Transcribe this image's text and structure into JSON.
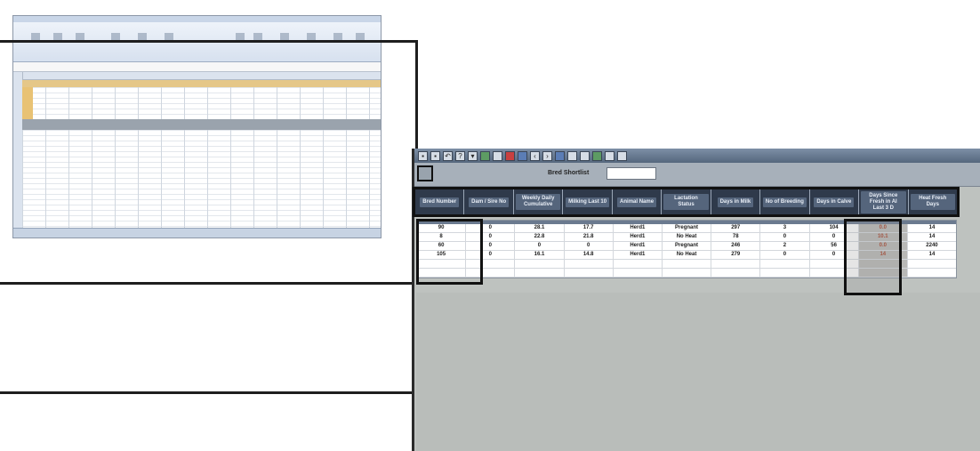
{
  "search": {
    "label": "Bred Shortlist",
    "value": ""
  },
  "table": {
    "headers": [
      "Bred Number",
      "Dam / Sire No",
      "Weekly Daily Cumulative",
      "Milking Last 10",
      "Animal Name",
      "Lactation Status",
      "Days in Milk",
      "No of Breeding",
      "Days in Calve",
      "Days Since Fresh in AI Last 3 D",
      "Heat Fresh Days"
    ],
    "rows": [
      [
        "90",
        "0",
        "28.1",
        "17.7",
        "Herd1",
        "Pregnant",
        "297",
        "3",
        "104",
        "0.0",
        "14"
      ],
      [
        "8",
        "0",
        "22.8",
        "21.8",
        "Herd1",
        "No Heat",
        "78",
        "0",
        "0",
        "10.1",
        "14"
      ],
      [
        "60",
        "0",
        "0",
        "0",
        "Herd1",
        "Pregnant",
        "246",
        "2",
        "56",
        "0.0",
        "2240"
      ],
      [
        "105",
        "0",
        "16.1",
        "14.8",
        "Herd1",
        "No Heat",
        "279",
        "0",
        "0",
        "14",
        "14"
      ],
      [
        "",
        "",
        "",
        "",
        "",
        "",
        "",
        "",
        "",
        "",
        ""
      ],
      [
        "",
        "",
        "",
        "",
        "",
        "",
        "",
        "",
        "",
        "",
        ""
      ]
    ],
    "highlight_column": 9
  },
  "toolbar_icons": [
    "save-icon",
    "print-icon",
    "undo-icon",
    "help-icon",
    "filter-icon",
    "copy-icon",
    "paste-icon",
    "delete-icon",
    "first-icon",
    "prev-icon",
    "next-icon",
    "last-icon",
    "chart-icon",
    "refresh-icon",
    "export-icon",
    "settings-icon",
    "exit-icon"
  ]
}
